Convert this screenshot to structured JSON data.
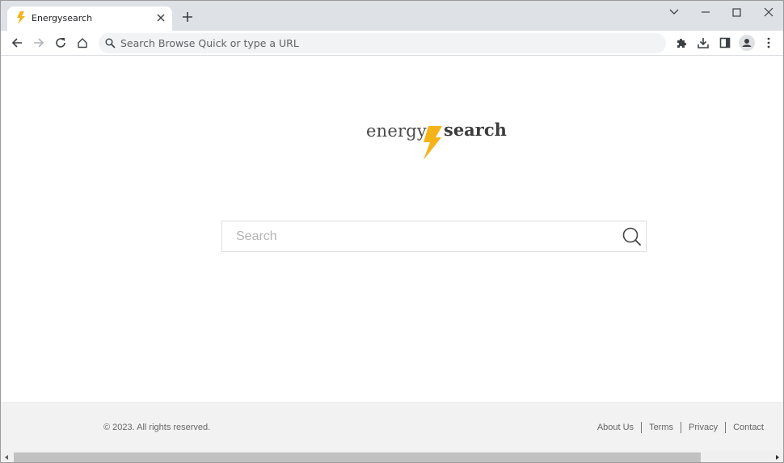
{
  "browser": {
    "tab": {
      "title": "Energysearch",
      "favicon": "lightning-bolt-icon",
      "close_icon": "close-icon"
    },
    "new_tab_icon": "plus-icon",
    "window_controls": [
      "chevron-down-icon",
      "minimize-icon",
      "maximize-icon",
      "close-icon"
    ],
    "nav": [
      "back-arrow-icon",
      "forward-arrow-icon",
      "reload-icon",
      "home-icon"
    ],
    "omnibox": {
      "icon": "search-icon",
      "placeholder": "Search Browse Quick or type a URL"
    },
    "toolbar_icons": [
      "extensions-puzzle-icon",
      "download-icon",
      "side-panel-icon",
      "profile-avatar-icon",
      "kebab-menu-icon"
    ]
  },
  "page": {
    "logo": {
      "left": "energy",
      "right": "search",
      "bolt_color": "#f5b31a"
    },
    "search": {
      "placeholder": "Search",
      "value": "",
      "button_icon": "magnifier-icon"
    }
  },
  "footer": {
    "copyright": "© 2023. All rights reserved.",
    "links": [
      "About Us",
      "Terms",
      "Privacy",
      "Contact"
    ]
  },
  "colors": {
    "accent": "#f5b31a",
    "tabstrip": "#dee1e6",
    "footer_bg": "#f2f2f2"
  }
}
